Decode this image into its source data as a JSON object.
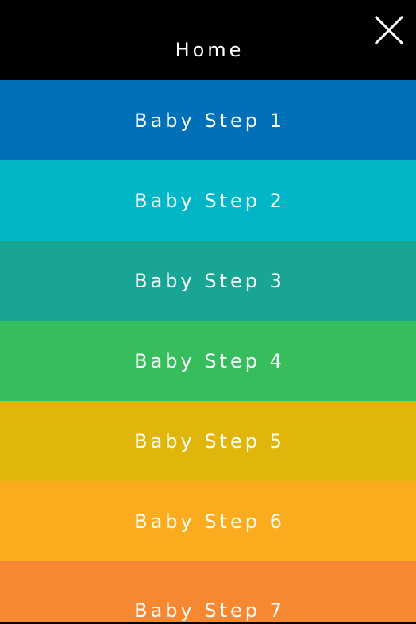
{
  "menu": {
    "items": [
      {
        "label": "Home",
        "color": "#000000"
      },
      {
        "label": "Baby Step 1",
        "color": "#0071b9"
      },
      {
        "label": "Baby Step 2",
        "color": "#00b6c7"
      },
      {
        "label": "Baby Step 3",
        "color": "#19a594"
      },
      {
        "label": "Baby Step 4",
        "color": "#37be5c"
      },
      {
        "label": "Baby Step 5",
        "color": "#e0b60a"
      },
      {
        "label": "Baby Step 6",
        "color": "#fbac1e"
      },
      {
        "label": "Baby Step 7",
        "color": "#f78832"
      }
    ],
    "close_icon": "close-icon",
    "text_color": "#ffffff"
  }
}
